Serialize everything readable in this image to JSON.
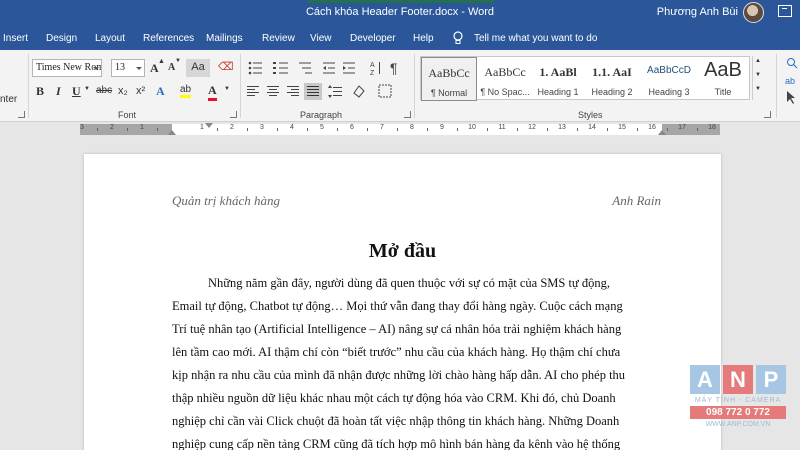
{
  "window": {
    "title": "Cách khóa Header Footer.docx  -  Word",
    "user_name": "Phương Anh Bùi"
  },
  "tabs": [
    {
      "label": "Insert"
    },
    {
      "label": "Design"
    },
    {
      "label": "Layout"
    },
    {
      "label": "References"
    },
    {
      "label": "Mailings"
    },
    {
      "label": "Review"
    },
    {
      "label": "View"
    },
    {
      "label": "Developer"
    },
    {
      "label": "Help"
    }
  ],
  "tell_me": {
    "placeholder": "Tell me what you want to do"
  },
  "ribbon": {
    "clipboard_partial_label": "nter",
    "font": {
      "group_label": "Font",
      "font_name": "Times New Roman",
      "font_size": "13",
      "grow_label": "A",
      "shrink_label": "A",
      "case_label": "Aa",
      "bold": "B",
      "italic": "I",
      "underline": "U",
      "strike": "abc",
      "subscript": "x₂",
      "superscript": "x²",
      "effects": "A",
      "highlight": "ab",
      "font_color": "A",
      "font_color_hex": "#e81123",
      "highlight_hex": "#ffff00"
    },
    "paragraph": {
      "group_label": "Paragraph"
    },
    "styles": {
      "group_label": "Styles",
      "items": [
        {
          "sample": "AaBbCc",
          "name": "¶ Normal"
        },
        {
          "sample": "AaBbCc",
          "name": "¶ No Spac..."
        },
        {
          "sample": "1. AaBl",
          "name": "Heading 1"
        },
        {
          "sample": "1.1. AaI",
          "name": "Heading 2"
        },
        {
          "sample": "AaBbCcD",
          "name": "Heading 3"
        },
        {
          "sample": "AaB",
          "name": "Title"
        }
      ]
    }
  },
  "ruler": {
    "numbers": [
      "3",
      "2",
      "1",
      "1",
      "2",
      "3",
      "4",
      "5",
      "6",
      "7",
      "8",
      "9",
      "10",
      "11",
      "12",
      "13",
      "14",
      "15",
      "16",
      "17",
      "18"
    ]
  },
  "document": {
    "header_left": "Quản trị khách hàng",
    "header_right": "Anh Rain",
    "heading": "Mở đầu",
    "lines": [
      "Những năm gần đây, người dùng đã quen thuộc với sự có mặt của SMS tự động,",
      "Email tự động, Chatbot tự động… Mọi thứ vẫn đang thay đổi hàng ngày. Cuộc cách mạng",
      "Trí tuệ nhân tạo (Artificial Intelligence – AI) nâng sự cá nhân hóa trải nghiệm khách hàng",
      "lên tầm cao mới. AI thậm chí còn “biết trước” nhu cầu của khách hàng. Họ thậm chí chưa",
      "kịp nhận ra nhu cầu của mình đã nhận được những lời chào hàng hấp dẫn. AI cho phép thu",
      "thập nhiều nguồn dữ liệu khác nhau một cách tự động hóa vào CRM. Khi đó, chủ Doanh",
      "nghiệp chỉ cần vài Click chuột đã hoàn tất việc nhập thông tin khách hàng. Những Doanh",
      "nghiệp cung cấp nền tảng CRM cũng đã tích hợp mô hình bán hàng đa kênh vào hệ thống"
    ]
  },
  "watermark": {
    "letters": [
      "A",
      "N",
      "P"
    ],
    "tagline": "MÁY TÍNH - CAMERA",
    "phone": "098 772 0 772",
    "website": "WWW.ANP.COM.VN"
  },
  "colors": {
    "word_blue": "#2b579a",
    "ribbon_bg": "#f3f3f3",
    "canvas_bg": "#e6e6e6"
  }
}
